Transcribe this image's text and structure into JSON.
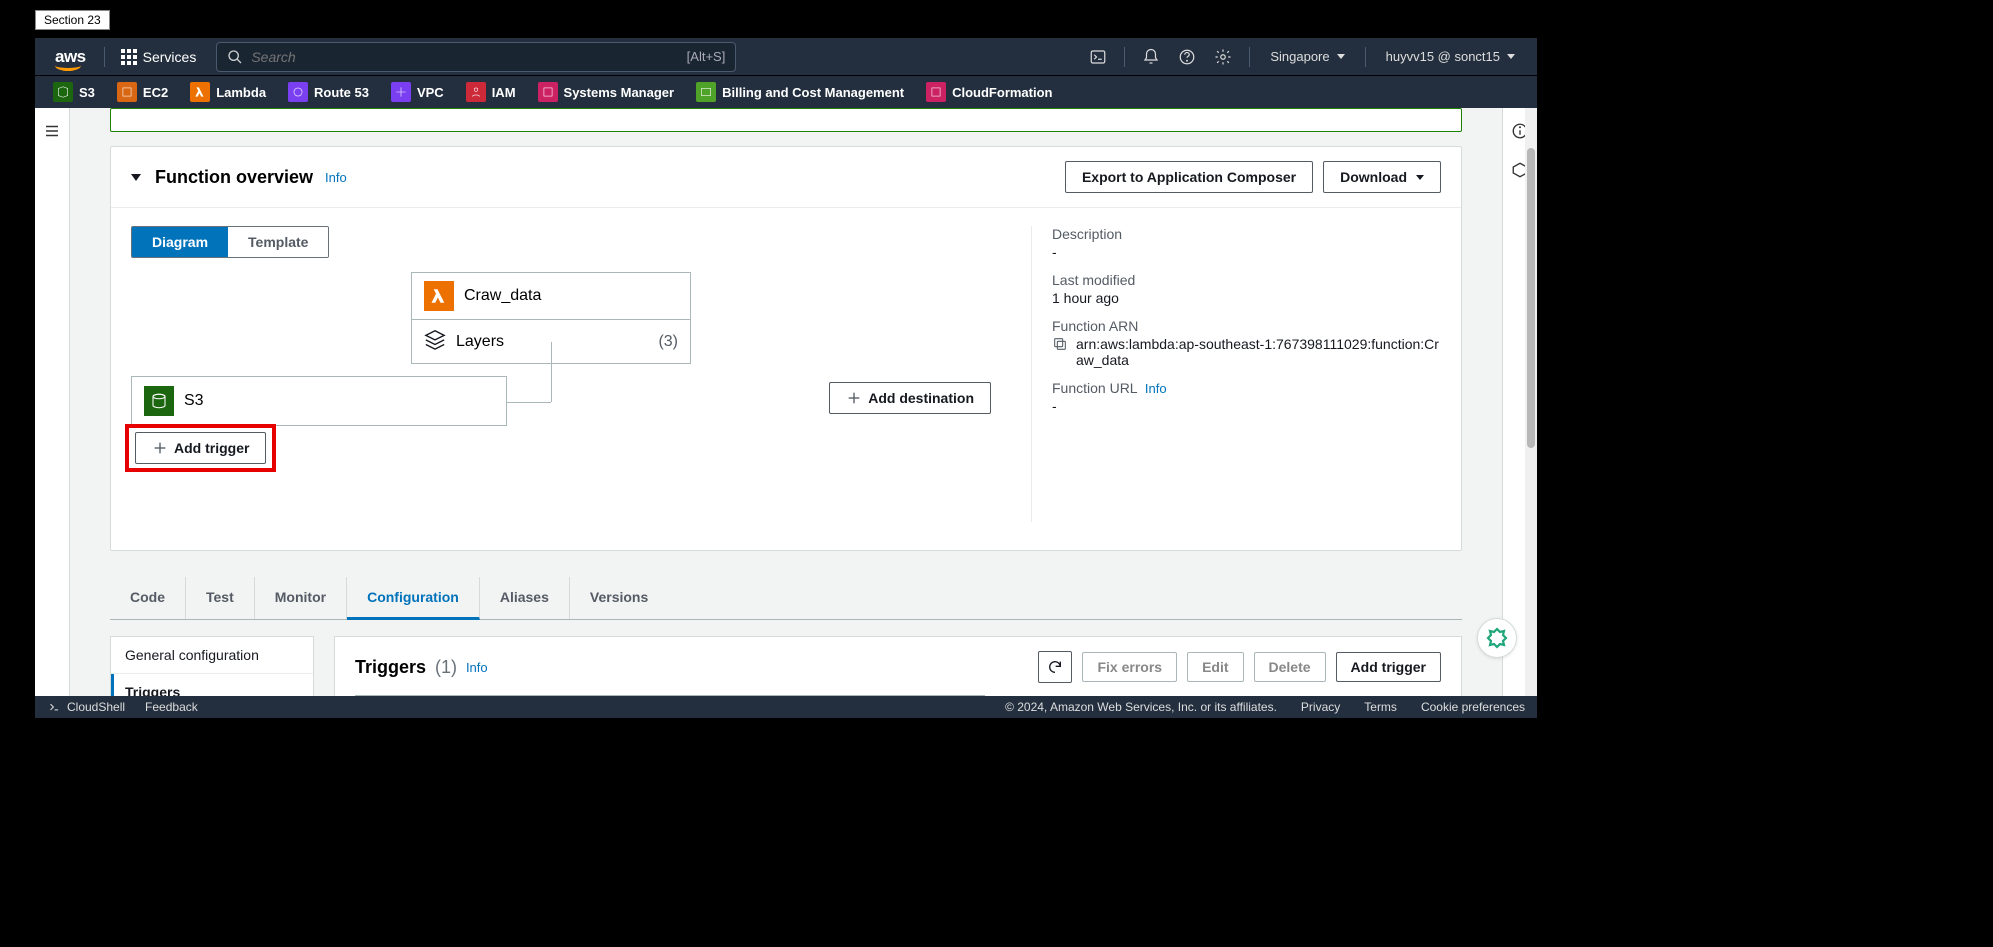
{
  "browserTab": "Section 23",
  "topNav": {
    "servicesLabel": "Services",
    "searchPlaceholder": "Search",
    "searchHint": "[Alt+S]",
    "region": "Singapore",
    "account": "huyvv15 @ sonct15"
  },
  "serviceBar": [
    {
      "name": "S3",
      "color": "#1b660f"
    },
    {
      "name": "EC2",
      "color": "#d86613"
    },
    {
      "name": "Lambda",
      "color": "#ed7100"
    },
    {
      "name": "Route 53",
      "color": "#7b3ff2"
    },
    {
      "name": "VPC",
      "color": "#7b3ff2"
    },
    {
      "name": "IAM",
      "color": "#cc2939"
    },
    {
      "name": "Systems Manager",
      "color": "#cc2264"
    },
    {
      "name": "Billing and Cost Management",
      "color": "#50a329"
    },
    {
      "name": "CloudFormation",
      "color": "#cc2264"
    }
  ],
  "overview": {
    "title": "Function overview",
    "info": "Info",
    "exportBtn": "Export to Application Composer",
    "downloadBtn": "Download",
    "toggle": {
      "diagram": "Diagram",
      "template": "Template"
    },
    "functionName": "Craw_data",
    "layersLabel": "Layers",
    "layersCount": "(3)",
    "triggerName": "S3",
    "addTrigger": "Add trigger",
    "addDestination": "Add destination"
  },
  "details": {
    "descLabel": "Description",
    "descValue": "-",
    "modifiedLabel": "Last modified",
    "modifiedValue": "1 hour ago",
    "arnLabel": "Function ARN",
    "arnValue": "arn:aws:lambda:ap-southeast-1:767398111029:function:Craw_data",
    "urlLabel": "Function URL",
    "urlInfo": "Info",
    "urlValue": "-"
  },
  "tabs": [
    "Code",
    "Test",
    "Monitor",
    "Configuration",
    "Aliases",
    "Versions"
  ],
  "activeTab": "Configuration",
  "configSideItems": [
    "General configuration",
    "Triggers"
  ],
  "activeSideItem": "Triggers",
  "triggersPanel": {
    "title": "Triggers",
    "count": "(1)",
    "info": "Info",
    "fixErrors": "Fix errors",
    "edit": "Edit",
    "delete": "Delete",
    "addTrigger": "Add trigger"
  },
  "footer": {
    "cloudshell": "CloudShell",
    "feedback": "Feedback",
    "copyright": "© 2024, Amazon Web Services, Inc. or its affiliates.",
    "privacy": "Privacy",
    "terms": "Terms",
    "cookies": "Cookie preferences"
  }
}
